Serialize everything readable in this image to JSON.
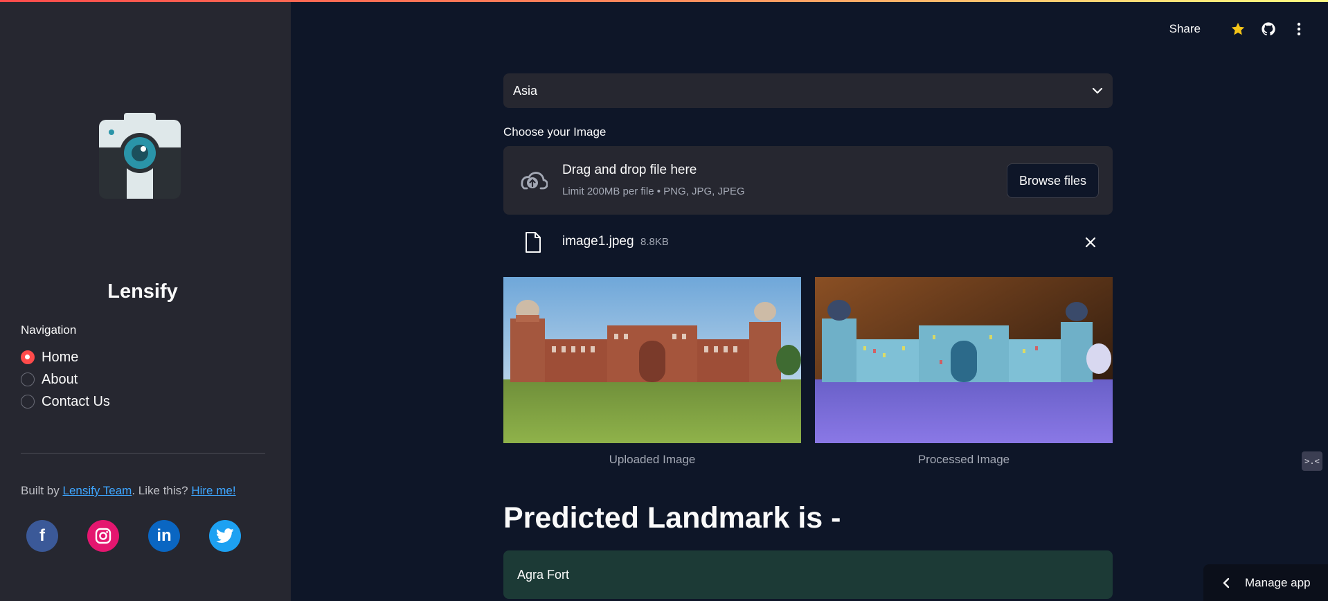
{
  "sidebar": {
    "app_name": "Lensify",
    "nav_label": "Navigation",
    "nav_items": [
      {
        "label": "Home",
        "checked": true
      },
      {
        "label": "About",
        "checked": false
      },
      {
        "label": "Contact Us",
        "checked": false
      }
    ],
    "built_by_prefix": "Built by ",
    "built_by_link": "Lensify Team",
    "built_by_mid": ". Like this? ",
    "hire_link": "Hire me!",
    "socials": [
      {
        "icon": "facebook-icon",
        "glyph": "f"
      },
      {
        "icon": "instagram-icon",
        "glyph": "◎"
      },
      {
        "icon": "linkedin-icon",
        "glyph": "in"
      },
      {
        "icon": "twitter-icon",
        "glyph": "t"
      }
    ]
  },
  "header": {
    "share_label": "Share",
    "icons": [
      "star-icon",
      "github-icon",
      "more-vertical-icon"
    ]
  },
  "main": {
    "region_select": "Asia",
    "upload_label": "Choose your Image",
    "dropzone_title": "Drag and drop file here",
    "dropzone_sub": "Limit 200MB per file • PNG, JPG, JPEG",
    "browse_label": "Browse files",
    "file_name": "image1.jpeg",
    "file_size": "8.8KB",
    "caption_uploaded": "Uploaded Image",
    "caption_processed": "Processed Image",
    "predicted_title": "Predicted Landmark is -",
    "predicted_value": "Agra Fort"
  },
  "footer": {
    "manage_app": "Manage app"
  },
  "colors": {
    "accent": "#ff4b4b",
    "link": "#3ea6ff",
    "success_bg": "#1c3a36"
  }
}
